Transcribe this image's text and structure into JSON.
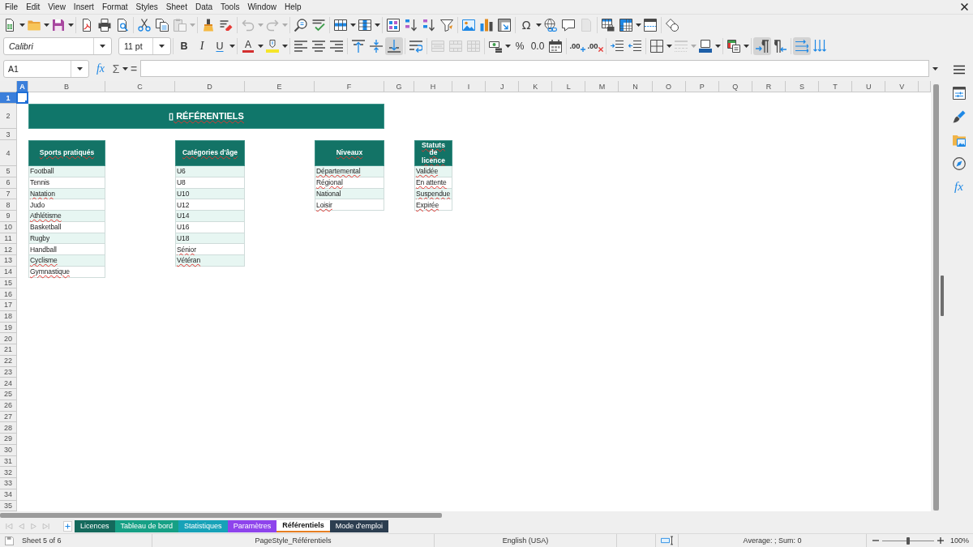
{
  "menu_bar": {
    "items": [
      "File",
      "Edit",
      "View",
      "Insert",
      "Format",
      "Styles",
      "Sheet",
      "Data",
      "Tools",
      "Window",
      "Help"
    ]
  },
  "standard_toolbar": {
    "buttons": [
      {
        "disabled": false
      },
      {
        "disabled": false
      },
      {
        "disabled": false
      },
      {
        "disabled": false
      },
      {
        "disabled": false
      },
      {
        "disabled": false
      },
      {
        "disabled": false
      },
      {
        "disabled": false
      },
      {
        "disabled": true
      },
      {
        "disabled": false
      },
      {
        "disabled": false
      },
      {
        "disabled": true
      },
      {
        "disabled": true
      },
      {
        "disabled": false
      },
      {
        "disabled": false
      },
      {
        "disabled": false
      },
      {
        "disabled": false
      },
      {
        "disabled": false
      },
      {
        "disabled": false
      },
      {
        "disabled": false
      },
      {
        "disabled": false
      },
      {
        "disabled": false
      },
      {
        "disabled": false
      },
      {
        "disabled": false
      },
      {
        "label": "Ω",
        "disabled": false
      },
      {
        "disabled": false
      },
      {
        "disabled": false
      },
      {
        "disabled": true
      },
      {
        "disabled": false
      },
      {
        "disabled": false
      },
      {
        "disabled": false
      },
      {
        "disabled": false
      }
    ]
  },
  "format_toolbar": {
    "font_name": "Calibri",
    "font_size": "11 pt",
    "buttons": [
      {
        "label": "B",
        "pressed": false,
        "disabled": false
      },
      {
        "label": "I",
        "pressed": false,
        "disabled": false
      },
      {
        "label": "U",
        "pressed": false,
        "disabled": false
      },
      {
        "label": "A",
        "pressed": false,
        "disabled": false
      },
      {
        "pressed": false,
        "disabled": false
      },
      {
        "pressed": false,
        "disabled": false
      },
      {
        "pressed": false,
        "disabled": false
      },
      {
        "pressed": false,
        "disabled": false
      },
      {
        "pressed": false,
        "disabled": false
      },
      {
        "pressed": false,
        "disabled": false
      },
      {
        "pressed": true,
        "disabled": false
      },
      {
        "pressed": false,
        "disabled": false
      },
      {
        "pressed": false,
        "disabled": true
      },
      {
        "pressed": false,
        "disabled": true
      },
      {
        "pressed": false,
        "disabled": true
      },
      {
        "pressed": false,
        "disabled": false
      },
      {
        "label": "%",
        "pressed": false,
        "disabled": false
      },
      {
        "label": "0.0",
        "pressed": false,
        "disabled": false
      },
      {
        "pressed": false,
        "disabled": false
      },
      {
        "label": ".00",
        "pressed": false,
        "disabled": false
      },
      {
        "label": ".00",
        "pressed": false,
        "disabled": false
      },
      {
        "pressed": false,
        "disabled": false
      },
      {
        "pressed": false,
        "disabled": false
      },
      {
        "pressed": false,
        "disabled": false
      },
      {
        "pressed": false,
        "disabled": true
      },
      {
        "pressed": false,
        "disabled": false
      },
      {
        "pressed": false,
        "disabled": false
      },
      {
        "pressed": true,
        "disabled": false
      },
      {
        "pressed": false,
        "disabled": false
      },
      {
        "pressed": true,
        "disabled": false
      },
      {
        "pressed": false,
        "disabled": false
      }
    ]
  },
  "formula_bar": {
    "name_box": "A1",
    "function_wizard": "fx",
    "sum": "Σ",
    "equals": "="
  },
  "sheet": {
    "columns": [
      {
        "label": "A",
        "selected": true
      },
      {
        "label": "B",
        "selected": false
      },
      {
        "label": "C",
        "selected": false
      },
      {
        "label": "D",
        "selected": false
      },
      {
        "label": "E",
        "selected": false
      },
      {
        "label": "F",
        "selected": false
      },
      {
        "label": "G",
        "selected": false
      },
      {
        "label": "H",
        "selected": false
      },
      {
        "label": "I",
        "selected": false
      },
      {
        "label": "J",
        "selected": false
      },
      {
        "label": "K",
        "selected": false
      },
      {
        "label": "L",
        "selected": false
      },
      {
        "label": "M",
        "selected": false
      },
      {
        "label": "N",
        "selected": false
      },
      {
        "label": "O",
        "selected": false
      },
      {
        "label": "P",
        "selected": false
      },
      {
        "label": "Q",
        "selected": false
      },
      {
        "label": "R",
        "selected": false
      },
      {
        "label": "S",
        "selected": false
      },
      {
        "label": "T",
        "selected": false
      },
      {
        "label": "U",
        "selected": false
      },
      {
        "label": "V",
        "selected": false
      }
    ],
    "rows": [
      {
        "label": "1",
        "selected": true
      },
      {
        "label": "2",
        "selected": false
      },
      {
        "label": "3",
        "selected": false
      },
      {
        "label": "4",
        "selected": false
      },
      {
        "label": "5",
        "selected": false
      },
      {
        "label": "6",
        "selected": false
      },
      {
        "label": "7",
        "selected": false
      },
      {
        "label": "8",
        "selected": false
      },
      {
        "label": "9",
        "selected": false
      },
      {
        "label": "10",
        "selected": false
      },
      {
        "label": "11",
        "selected": false
      },
      {
        "label": "12",
        "selected": false
      },
      {
        "label": "13",
        "selected": false
      },
      {
        "label": "14",
        "selected": false
      },
      {
        "label": "15",
        "selected": false
      },
      {
        "label": "16",
        "selected": false
      },
      {
        "label": "17",
        "selected": false
      },
      {
        "label": "18",
        "selected": false
      },
      {
        "label": "19",
        "selected": false
      },
      {
        "label": "20",
        "selected": false
      },
      {
        "label": "21",
        "selected": false
      },
      {
        "label": "22",
        "selected": false
      },
      {
        "label": "23",
        "selected": false
      },
      {
        "label": "24",
        "selected": false
      },
      {
        "label": "25",
        "selected": false
      },
      {
        "label": "26",
        "selected": false
      },
      {
        "label": "27",
        "selected": false
      },
      {
        "label": "28",
        "selected": false
      },
      {
        "label": "29",
        "selected": false
      },
      {
        "label": "30",
        "selected": false
      },
      {
        "label": "31",
        "selected": false
      },
      {
        "label": "32",
        "selected": false
      },
      {
        "label": "33",
        "selected": false
      },
      {
        "label": "34",
        "selected": false
      },
      {
        "label": "35",
        "selected": false
      }
    ],
    "title": {
      "text": "▯ RÉFÉRENTIELS",
      "spell_error": true
    },
    "tables": [
      {
        "header": {
          "text": "Sports pratiqués",
          "spell_error": true
        },
        "items": [
          {
            "text": "Football",
            "spell_error": false
          },
          {
            "text": "Tennis",
            "spell_error": false
          },
          {
            "text": "Natation",
            "spell_error": true
          },
          {
            "text": "Judo",
            "spell_error": false
          },
          {
            "text": "Athlétisme",
            "spell_error": true
          },
          {
            "text": "Basketball",
            "spell_error": false
          },
          {
            "text": "Rugby",
            "spell_error": false
          },
          {
            "text": "Handball",
            "spell_error": false
          },
          {
            "text": "Cyclisme",
            "spell_error": true
          },
          {
            "text": "Gymnastique",
            "spell_error": true
          }
        ]
      },
      {
        "header": {
          "text": "Catégories d'âge",
          "spell_error": true
        },
        "items": [
          {
            "text": "U6",
            "spell_error": false
          },
          {
            "text": "U8",
            "spell_error": false
          },
          {
            "text": "U10",
            "spell_error": false
          },
          {
            "text": "U12",
            "spell_error": false
          },
          {
            "text": "U14",
            "spell_error": false
          },
          {
            "text": "U16",
            "spell_error": false
          },
          {
            "text": "U18",
            "spell_error": false
          },
          {
            "text": "Sénior",
            "spell_error": true
          },
          {
            "text": "Vétéran",
            "spell_error": true
          }
        ]
      },
      {
        "header": {
          "text": "Niveaux",
          "spell_error": true
        },
        "items": [
          {
            "text": "Départemental",
            "spell_error": true
          },
          {
            "text": "Régional",
            "spell_error": true
          },
          {
            "text": "National",
            "spell_error": false
          },
          {
            "text": "Loisir",
            "spell_error": true
          }
        ]
      },
      {
        "header": {
          "text": "Statuts de licence",
          "spell_error": true
        },
        "items": [
          {
            "text": "Validée",
            "spell_error": true
          },
          {
            "text": "En attente",
            "spell_error": true
          },
          {
            "text": "Suspendue",
            "spell_error": true
          },
          {
            "text": "Expirée",
            "spell_error": true
          }
        ]
      }
    ]
  },
  "sheet_tabs": {
    "nav_buttons": [
      {
        "disabled": true
      },
      {
        "disabled": true
      },
      {
        "disabled": true
      },
      {
        "disabled": true
      }
    ],
    "tabs": [
      {
        "label": "Licences",
        "color": "#14695c",
        "selected": false
      },
      {
        "label": "Tableau de bord",
        "color": "#16a085",
        "selected": false
      },
      {
        "label": "Statistiques",
        "color": "#17a2b8",
        "selected": false
      },
      {
        "label": "Paramètres",
        "color": "#8e44ec",
        "selected": false
      },
      {
        "label": "Référentiels",
        "color": "#e67e22",
        "selected": true
      },
      {
        "label": "Mode d'emploi",
        "color": "#2c3e50",
        "selected": false
      }
    ]
  },
  "sidebar": {
    "functions_label": "fx"
  },
  "status_bar": {
    "sheet_position": "Sheet 5 of 6",
    "page_style": "PageStyle_Référentiels",
    "language": "English (USA)",
    "selection_summary": "Average: ; Sum: 0",
    "zoom": {
      "level": 0.5,
      "label": "100%"
    }
  }
}
